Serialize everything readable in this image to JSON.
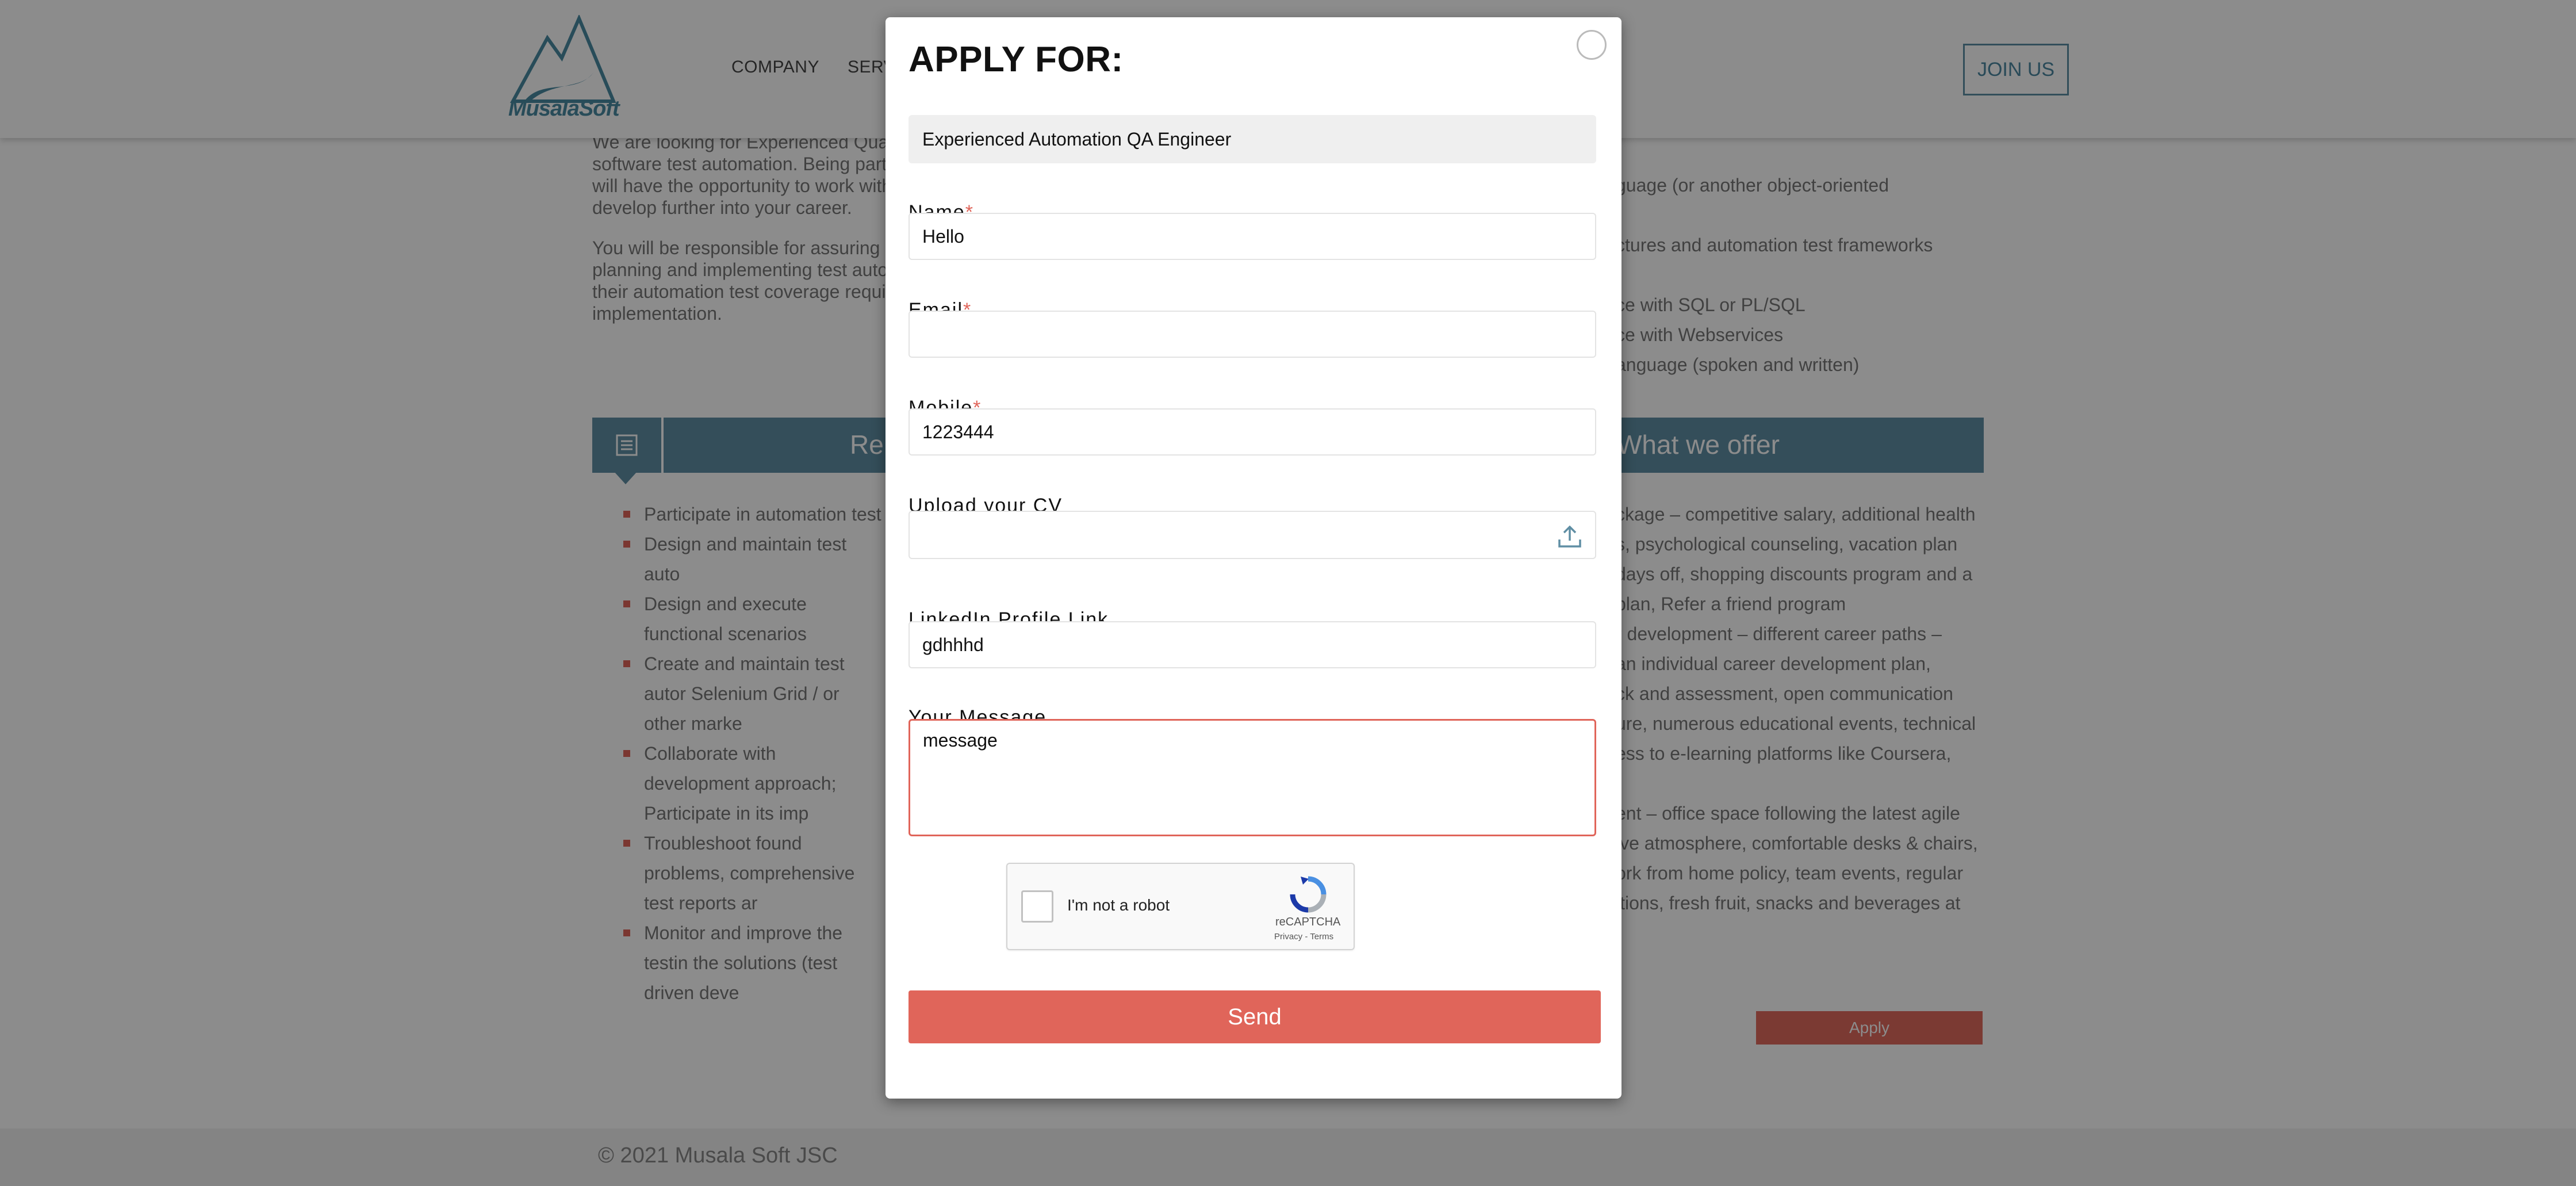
{
  "header": {
    "logo_text": "MusalaSoft",
    "nav": [
      "COMPANY",
      "SERV"
    ],
    "join_label": "JOIN US"
  },
  "background": {
    "intro_lines": [
      "We are looking for Experienced Quali",
      "software test automation. Being part",
      "will have the opportunity to work with",
      "develop further into your career."
    ],
    "resp_lines": [
      "You will be responsible for assuring p",
      "planning and implementing test autom",
      "their automation test coverage requir",
      "implementation."
    ],
    "req_lines": [
      "guage (or another object-oriented",
      "ctures and automation test frameworks",
      "ce with SQL or PL/SQL",
      "ce with Webservices",
      "anguage (spoken and written)"
    ],
    "left_bar_title": "Re",
    "right_bar_title": "What we offer",
    "left_list": [
      "Participate in automation test",
      "Design and maintain test auto",
      "Design and execute functional scenarios",
      "Create and maintain test autor Selenium Grid / or other marke",
      "Collaborate with development approach; Participate in its imp",
      "Troubleshoot found problems, comprehensive test reports ar",
      "Monitor and improve the testin the solutions (test driven deve"
    ],
    "offer_lines": [
      "ckage – competitive salary, additional health",
      "s, psychological counseling, vacation plan",
      "days off, shopping discounts program and a",
      "plan, Refer a friend program",
      "r development – different career paths –",
      "an individual career development plan,",
      "ck and assessment, open communication",
      "ure, numerous educational events, technical",
      "ess to e-learning platforms like Coursera,",
      "",
      "ent – office space following the latest agile",
      "ive atmosphere, comfortable desks & chairs,",
      "ork from home policy, team events, regular",
      "itions, fresh fruit, snacks and beverages at"
    ],
    "apply_label": "Apply",
    "copyright": "© 2021 Musala Soft JSC"
  },
  "modal": {
    "title": "APPLY FOR:",
    "position_value": "Experienced Automation QA Engineer",
    "name_label": "Name",
    "name_value": "Hello",
    "email_label": "Email",
    "email_value": "",
    "mobile_label": "Mobile",
    "mobile_value": "1223444",
    "cv_label": "Upload your CV",
    "linkedin_label": "LinkedIn Profile Link",
    "linkedin_value": "gdhhhd",
    "message_label": "Your Message",
    "message_value": "message",
    "required_mark": "*",
    "captcha": {
      "label": "I'm not a robot",
      "brand": "reCAPTCHA",
      "links": "Privacy - Terms"
    },
    "send_label": "Send"
  },
  "colors": {
    "accent": "#e0655a",
    "brand_blue": "#5f8ea4"
  }
}
